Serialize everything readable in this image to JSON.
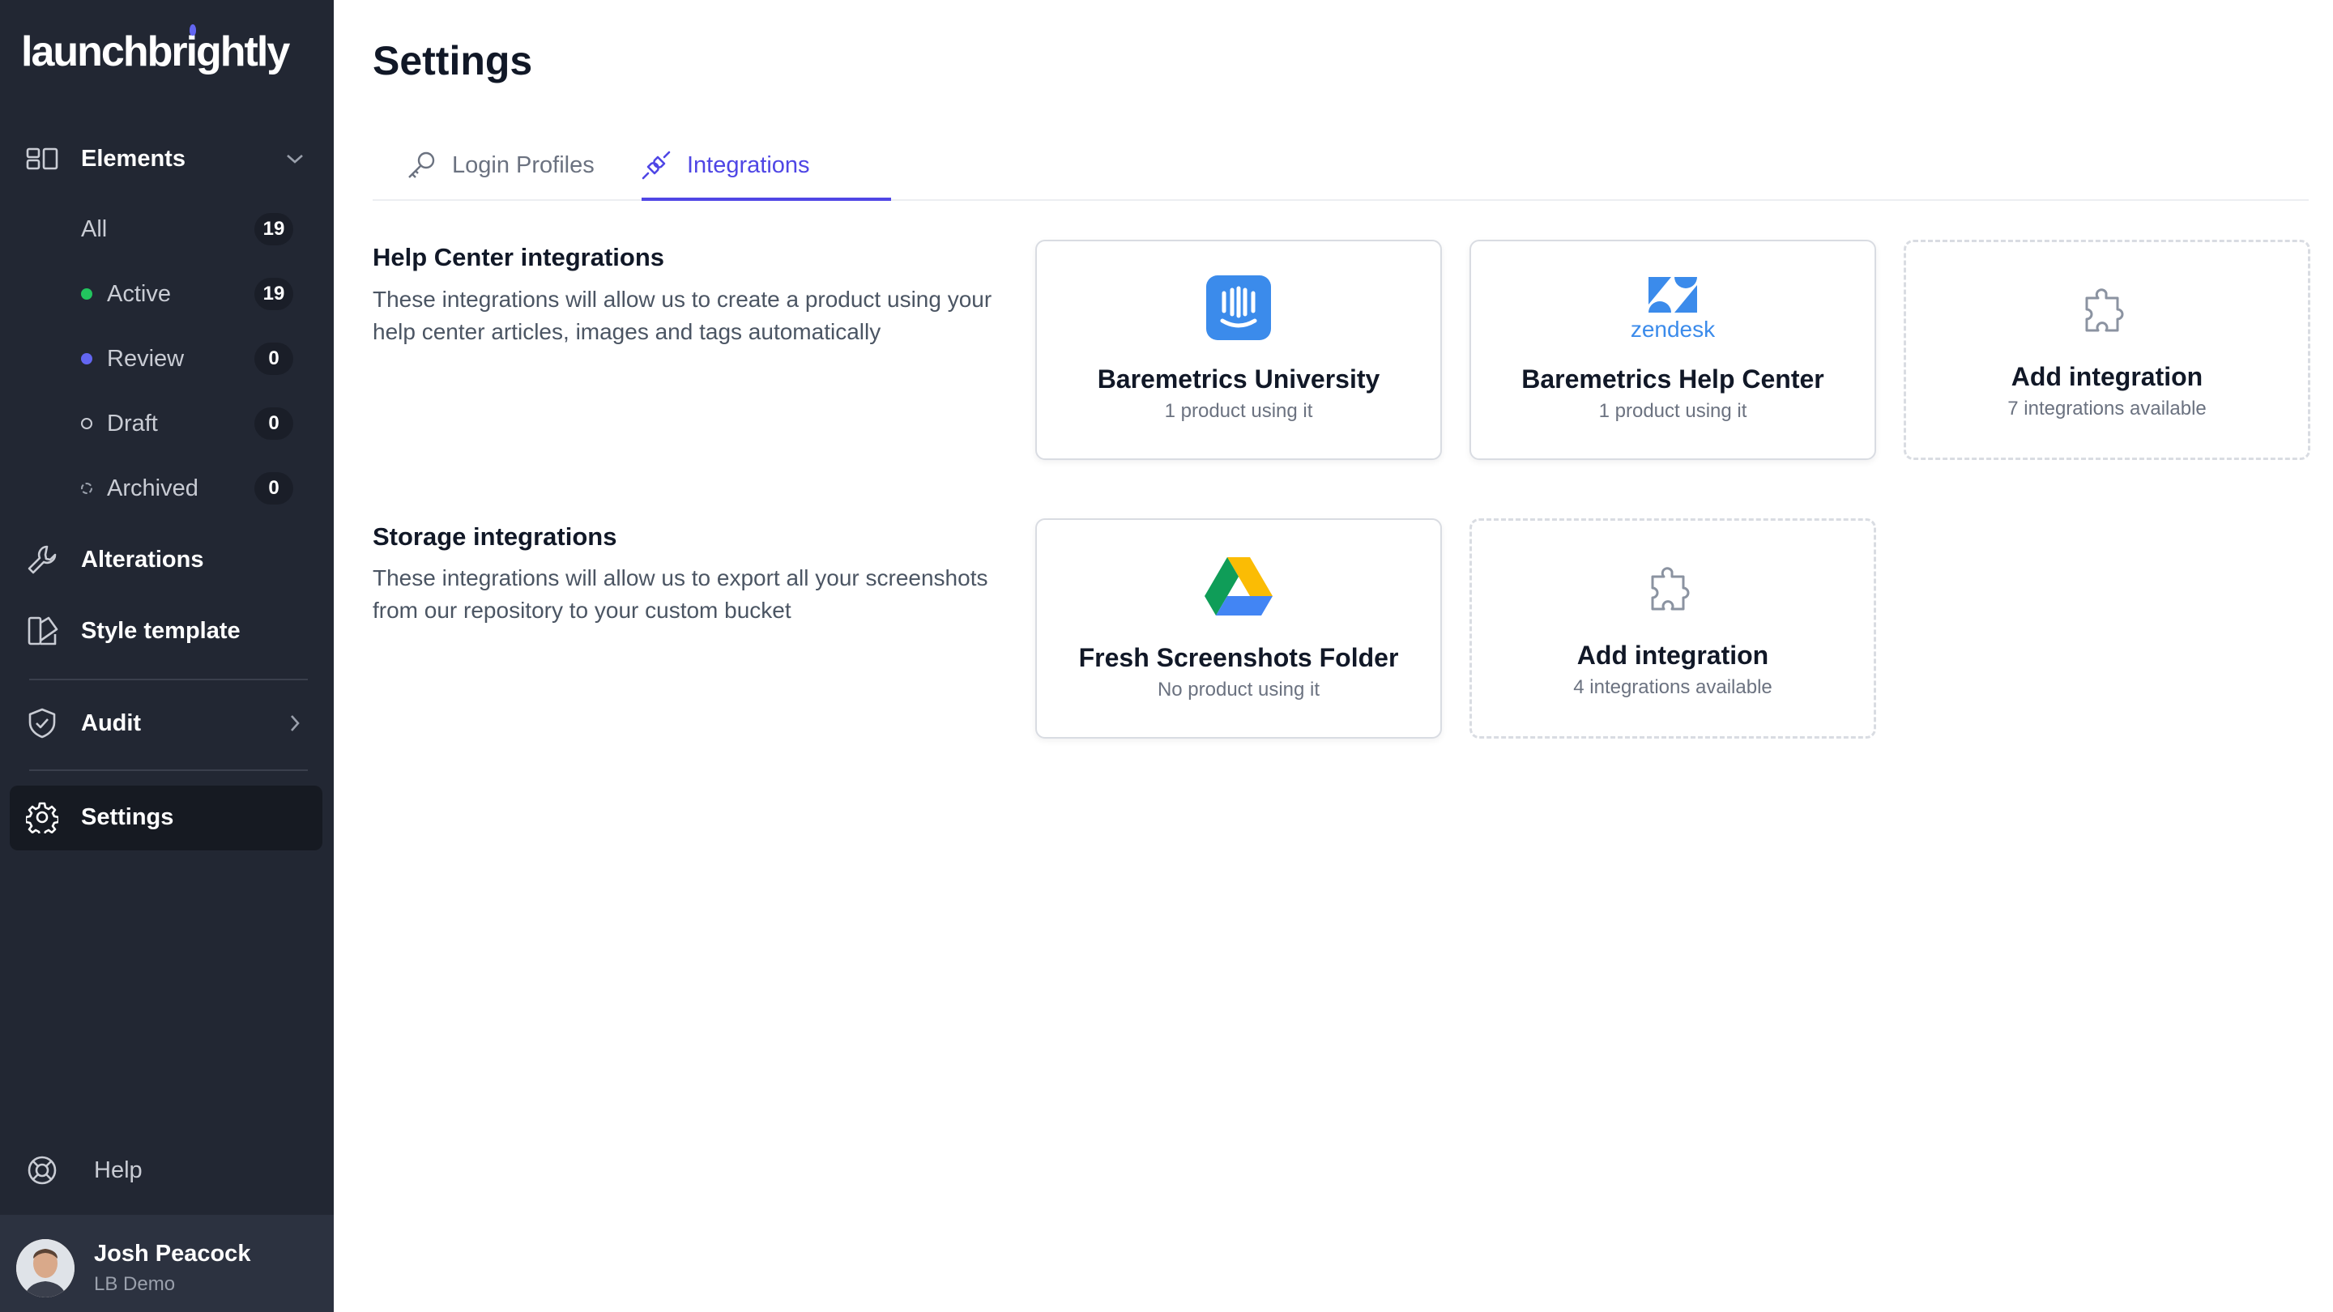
{
  "app": {
    "logo_text": "launchbrightly"
  },
  "sidebar": {
    "elements_label": "Elements",
    "sub_items": [
      {
        "label": "All",
        "count": "19",
        "color": ""
      },
      {
        "label": "Active",
        "count": "19",
        "color": "#22c55e"
      },
      {
        "label": "Review",
        "count": "0",
        "color": "#6366f1"
      },
      {
        "label": "Draft",
        "count": "0",
        "color": "hollow"
      },
      {
        "label": "Archived",
        "count": "0",
        "color": "dashed"
      }
    ],
    "alterations_label": "Alterations",
    "style_template_label": "Style template",
    "audit_label": "Audit",
    "settings_label": "Settings",
    "help_label": "Help",
    "user": {
      "name": "Josh Peacock",
      "org": "LB Demo"
    }
  },
  "page": {
    "title": "Settings",
    "tabs": [
      {
        "label": "Login Profiles",
        "active": false
      },
      {
        "label": "Integrations",
        "active": true
      }
    ],
    "accent": "#4f46e5"
  },
  "help_center": {
    "title": "Help Center integrations",
    "description": "These integrations will allow us to create a product using your help center articles, images and tags automatically",
    "cards": [
      {
        "title": "Baremetrics University",
        "subtitle": "1 product using it",
        "icon": "intercom-logo"
      },
      {
        "title": "Baremetrics Help Center",
        "subtitle": "1 product using it",
        "icon": "zendesk-logo",
        "logo_text": "zendesk"
      },
      {
        "title": "Add integration",
        "subtitle": "7 integrations available",
        "icon": "puzzle-icon"
      }
    ]
  },
  "storage": {
    "title": "Storage integrations",
    "description": "These integrations will allow us to export all your screenshots from our repository to your custom bucket",
    "cards": [
      {
        "title": "Fresh Screenshots Folder",
        "subtitle": "No product using it",
        "icon": "google-drive-logo"
      },
      {
        "title": "Add integration",
        "subtitle": "4 integrations available",
        "icon": "puzzle-icon"
      }
    ]
  }
}
